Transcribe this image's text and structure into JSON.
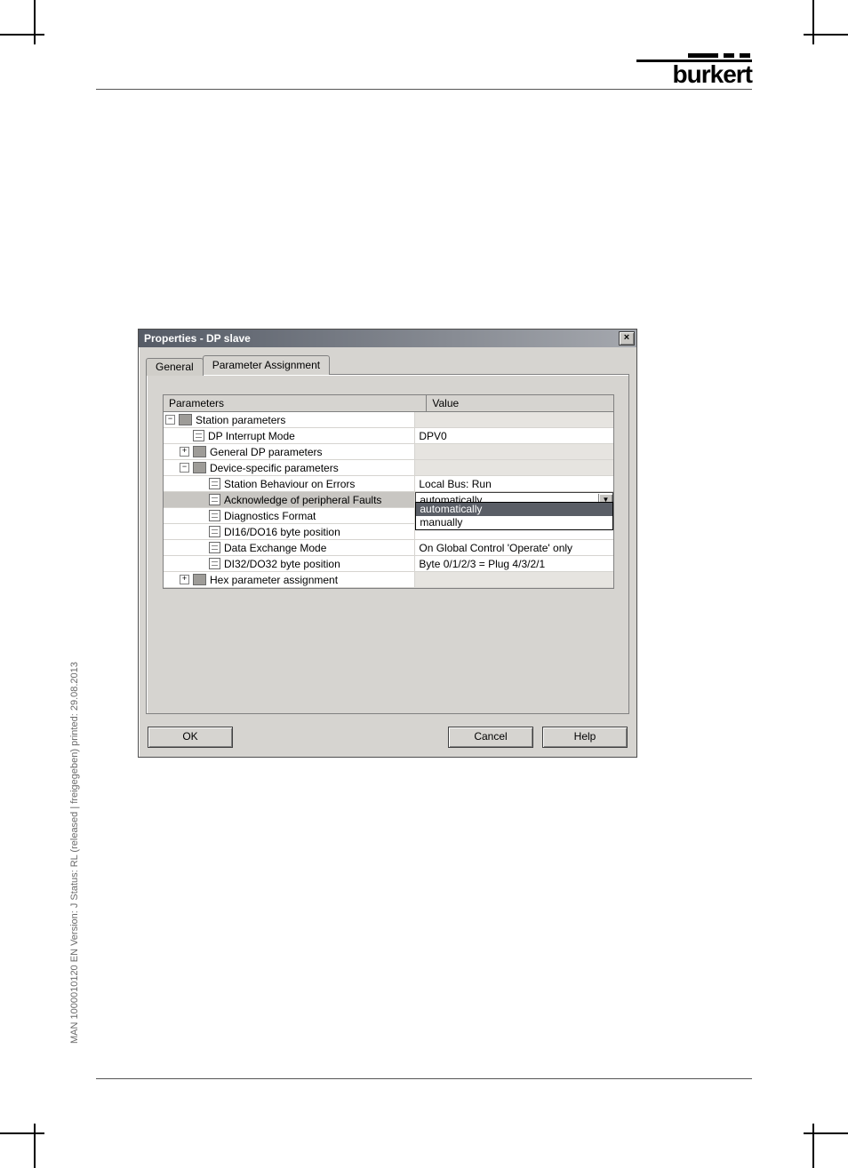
{
  "document": {
    "side_text": "MAN 1000010120 EN Version: J Status: RL (released | freigegeben) printed: 29.08.2013",
    "logo_text": "burkert"
  },
  "dialog": {
    "title": "Properties - DP slave",
    "tabs": {
      "general": "General",
      "param": "Parameter Assignment"
    },
    "grid_headers": {
      "param": "Parameters",
      "value": "Value"
    },
    "tree": {
      "station_parameters": "Station parameters",
      "dp_interrupt_mode": "DP Interrupt Mode",
      "dp_interrupt_mode_value": "DPV0",
      "general_dp_parameters": "General DP parameters",
      "device_specific_parameters": "Device-specific parameters",
      "station_behaviour": "Station Behaviour on Errors",
      "station_behaviour_value": "Local Bus: Run",
      "ack_faults": "Acknowledge of peripheral Faults",
      "ack_faults_value": "automatically",
      "diagnostics_format": "Diagnostics Format",
      "diagnostics_format_value": "",
      "di16": "DI16/DO16 byte position",
      "di16_value": "",
      "data_exchange": "Data Exchange Mode",
      "data_exchange_value": "On Global Control 'Operate' only",
      "di32": "DI32/DO32 byte position",
      "di32_value": "Byte 0/1/2/3 = Plug 4/3/2/1",
      "hex_param": "Hex parameter assignment"
    },
    "dropdown": {
      "opt1": "automatically",
      "opt2": "manually"
    },
    "buttons": {
      "ok": "OK",
      "cancel": "Cancel",
      "help": "Help"
    }
  }
}
